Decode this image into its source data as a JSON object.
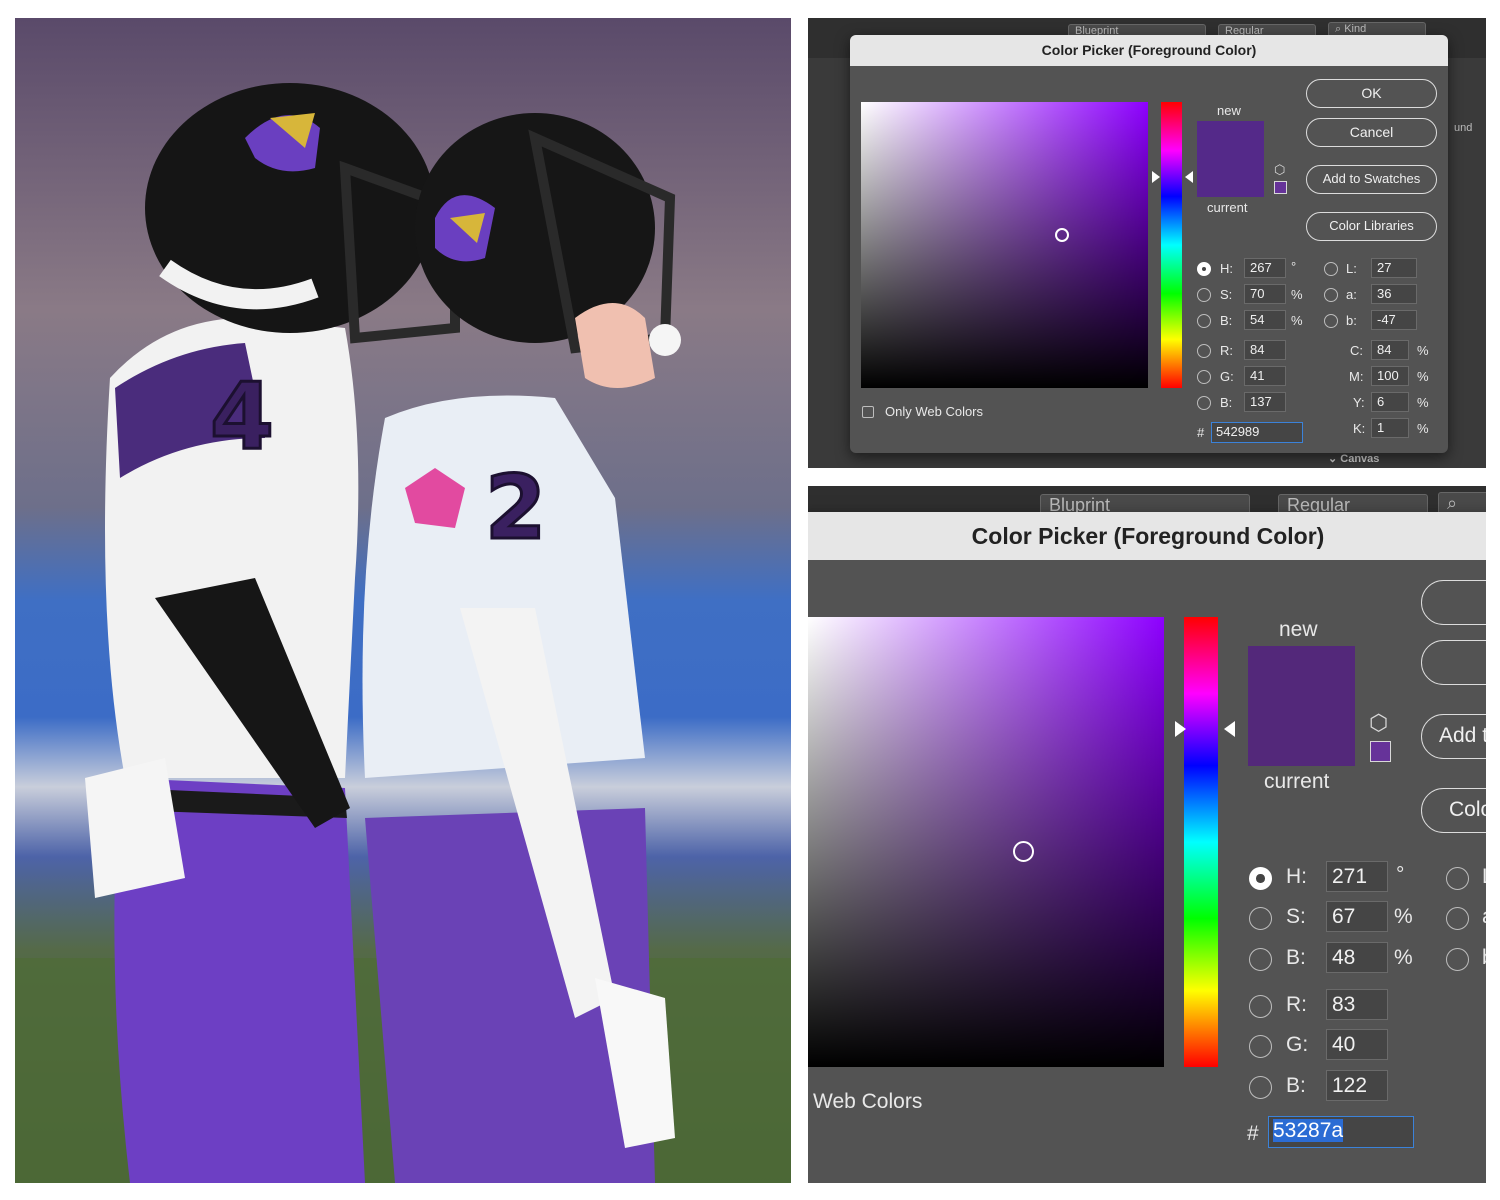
{
  "colors": {
    "new_swatch_1": "#542989",
    "new_swatch_2": "#53287a",
    "websafe_swatch": "#663399",
    "hex_highlight": "#2b6cd4"
  },
  "panel1": {
    "bg_fields": {
      "field1": "Blueprint",
      "field2": "Regular",
      "search": "Kind",
      "right_label": "und",
      "canvas": "Canvas"
    },
    "dialog": {
      "title": "Color Picker (Foreground Color)",
      "new_label": "new",
      "current_label": "current",
      "buttons": {
        "ok": "OK",
        "cancel": "Cancel",
        "add_swatches": "Add to Swatches",
        "color_libraries": "Color Libraries"
      },
      "only_web_colors": "Only Web Colors",
      "hsb": [
        {
          "label": "H:",
          "value": "267",
          "unit": "°"
        },
        {
          "label": "S:",
          "value": "70",
          "unit": "%"
        },
        {
          "label": "B:",
          "value": "54",
          "unit": "%"
        }
      ],
      "rgb": [
        {
          "label": "R:",
          "value": "84"
        },
        {
          "label": "G:",
          "value": "41"
        },
        {
          "label": "B:",
          "value": "137"
        }
      ],
      "lab": [
        {
          "label": "L:",
          "value": "27"
        },
        {
          "label": "a:",
          "value": "36"
        },
        {
          "label": "b:",
          "value": "-47"
        }
      ],
      "cmyk": [
        {
          "label": "C:",
          "value": "84",
          "unit": "%"
        },
        {
          "label": "M:",
          "value": "100",
          "unit": "%"
        },
        {
          "label": "Y:",
          "value": "6",
          "unit": "%"
        },
        {
          "label": "K:",
          "value": "1",
          "unit": "%"
        }
      ],
      "hash": "#",
      "hex": "542989"
    }
  },
  "panel2": {
    "bg_fields": {
      "field1": "Bluprint",
      "field2": "Regular"
    },
    "dialog": {
      "title": "Color Picker (Foreground Color)",
      "new_label": "new",
      "current_label": "current",
      "buttons": {
        "ok": "",
        "cancel": "C",
        "add_swatches": "Add t",
        "color_libraries": "Colo"
      },
      "only_web_colors": "Web Colors",
      "hsb": [
        {
          "label": "H:",
          "value": "271",
          "unit": "°"
        },
        {
          "label": "S:",
          "value": "67",
          "unit": "%"
        },
        {
          "label": "B:",
          "value": "48",
          "unit": "%"
        }
      ],
      "rgb": [
        {
          "label": "R:",
          "value": "83"
        },
        {
          "label": "G:",
          "value": "40"
        },
        {
          "label": "B:",
          "value": "122"
        }
      ],
      "lab_partial": [
        {
          "label": "L"
        },
        {
          "label": "a"
        },
        {
          "label": "b"
        }
      ],
      "hash": "#",
      "hex": "53287a"
    }
  }
}
